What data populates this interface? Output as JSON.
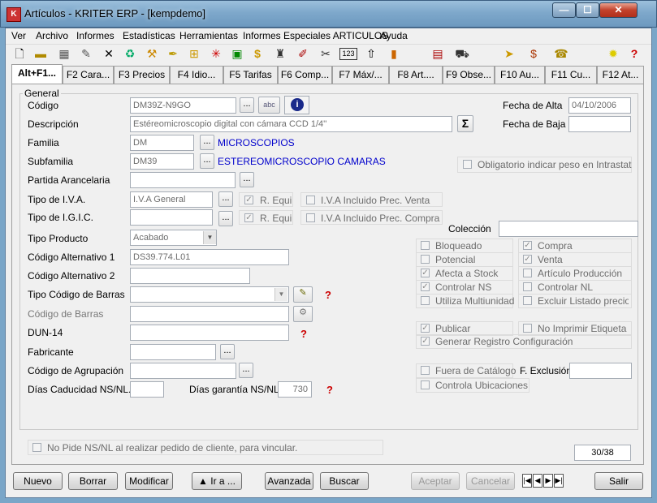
{
  "window": {
    "title": "Artículos - KRITER ERP - [kempdemo]",
    "min": "—",
    "max": "☐",
    "close": "✕"
  },
  "menu": [
    "Ver",
    "Archivo",
    "Informes",
    "Estadísticas",
    "Herramientas",
    "Informes Especiales ARTICULOS",
    "Ayuda"
  ],
  "toolbar": [
    "new-doc-icon",
    "open-folder-icon",
    "save-icon",
    "edit-icon",
    "delete-icon",
    "tool-icon",
    "tool-icon",
    "pen-icon",
    "tree-icon",
    "snowflake-icon",
    "box-icon",
    "dollar-icon",
    "stamp-icon",
    "brush-icon",
    "wrench-icon",
    "numbers-icon",
    "upload-icon",
    "bar-chart-icon",
    "calculator-icon",
    "cart-icon",
    "truck-icon",
    "moneybag-icon",
    "phone-icon",
    "bulb-icon",
    "help-icon"
  ],
  "tabs": [
    "Alt+F1...",
    "F2 Cara...",
    "F3 Precios",
    "F4 Idio...",
    "F5 Tarifas",
    "F6 Comp...",
    "F7 Máx/...",
    "F8 Art....",
    "F9 Obse...",
    "F10 Au...",
    "F11 Cu...",
    "F12 At..."
  ],
  "general": {
    "legend": "General",
    "codigo_label": "Código",
    "codigo": "DM39Z-N9GO",
    "fecha_alta_label": "Fecha de Alta",
    "fecha_alta": "04/10/2006",
    "descripcion_label": "Descripción",
    "descripcion": "Estéreomicroscopio digital con cámara CCD 1/4''",
    "fecha_baja_label": "Fecha de Baja",
    "fecha_baja": "",
    "familia_label": "Familia",
    "familia": "DM",
    "familia_desc": "MICROSCOPIOS",
    "subfamilia_label": "Subfamilia",
    "subfamilia": "DM39",
    "subfamilia_desc": "ESTEREOMICROSCOPIO CAMARAS",
    "intrastat_label": "Obligatorio indicar peso en Intrastat",
    "partida_label": "Partida Arancelaria",
    "partida": "",
    "iva_label": "Tipo de I.V.A.",
    "iva": "I.V.A General",
    "igic_label": "Tipo de I.G.I.C.",
    "igic": "",
    "requi": "R. Equi",
    "iva_incl_venta": "I.V.A Incluido Prec. Venta",
    "iva_incl_compra": "I.V.A Incluido Prec. Compra",
    "coleccion_label": "Colección",
    "coleccion": "",
    "tipo_producto_label": "Tipo Producto",
    "tipo_producto": "Acabado",
    "alt1_label": "Código Alternativo 1",
    "alt1": "DS39.774.L01",
    "alt2_label": "Código Alternativo 2",
    "alt2": "",
    "tipo_barras_label": "Tipo Código de Barras",
    "tipo_barras": "",
    "barras_label": "Código de Barras",
    "barras": "",
    "dun_label": "DUN-14",
    "dun": "",
    "fabricante_label": "Fabricante",
    "fabricante": "",
    "agrupacion_label": "Código de Agrupación",
    "agrupacion": "",
    "dias_ns_label": "Días Caducidad NS/NL.",
    "dias_ns": "",
    "dias_garantia_label": "Días garantía NS/NL.",
    "dias_garantia": "730",
    "f_exclusion_label": "F. Exclusión",
    "f_exclusion": ""
  },
  "checks": {
    "bloqueado": "Bloqueado",
    "compra": "Compra",
    "potencial": "Potencial",
    "venta": "Venta",
    "afecta_stock": "Afecta a Stock",
    "articulo_produccion": "Artículo Producción",
    "controlar_ns": "Controlar NS",
    "controlar_nl": "Controlar NL",
    "utiliza_multiunidad": "Utiliza Multiunidad",
    "excluir_listado": "Excluir Listado precio n",
    "publicar": "Publicar",
    "no_imprimir": "No Imprimir Etiqueta",
    "generar_registro": "Generar Registro Configuración",
    "fuera_catalogo": "Fuera de Catálogo",
    "controla_ubicaciones": "Controla Ubicaciones",
    "no_pide": "No Pide NS/NL al realizar pedido de cliente, para vincular."
  },
  "record_counter": "30/38",
  "buttons": {
    "nuevo": "Nuevo",
    "borrar": "Borrar",
    "modificar": "Modificar",
    "ir_a": "▲ Ir a ...",
    "avanzada": "Avanzada",
    "buscar": "Buscar",
    "aceptar": "Aceptar",
    "cancelar": "Cancelar",
    "salir": "Salir"
  },
  "sbtn_dots": "...",
  "spell": "abc",
  "info": "i",
  "sigma": "Σ",
  "help_q": "?"
}
